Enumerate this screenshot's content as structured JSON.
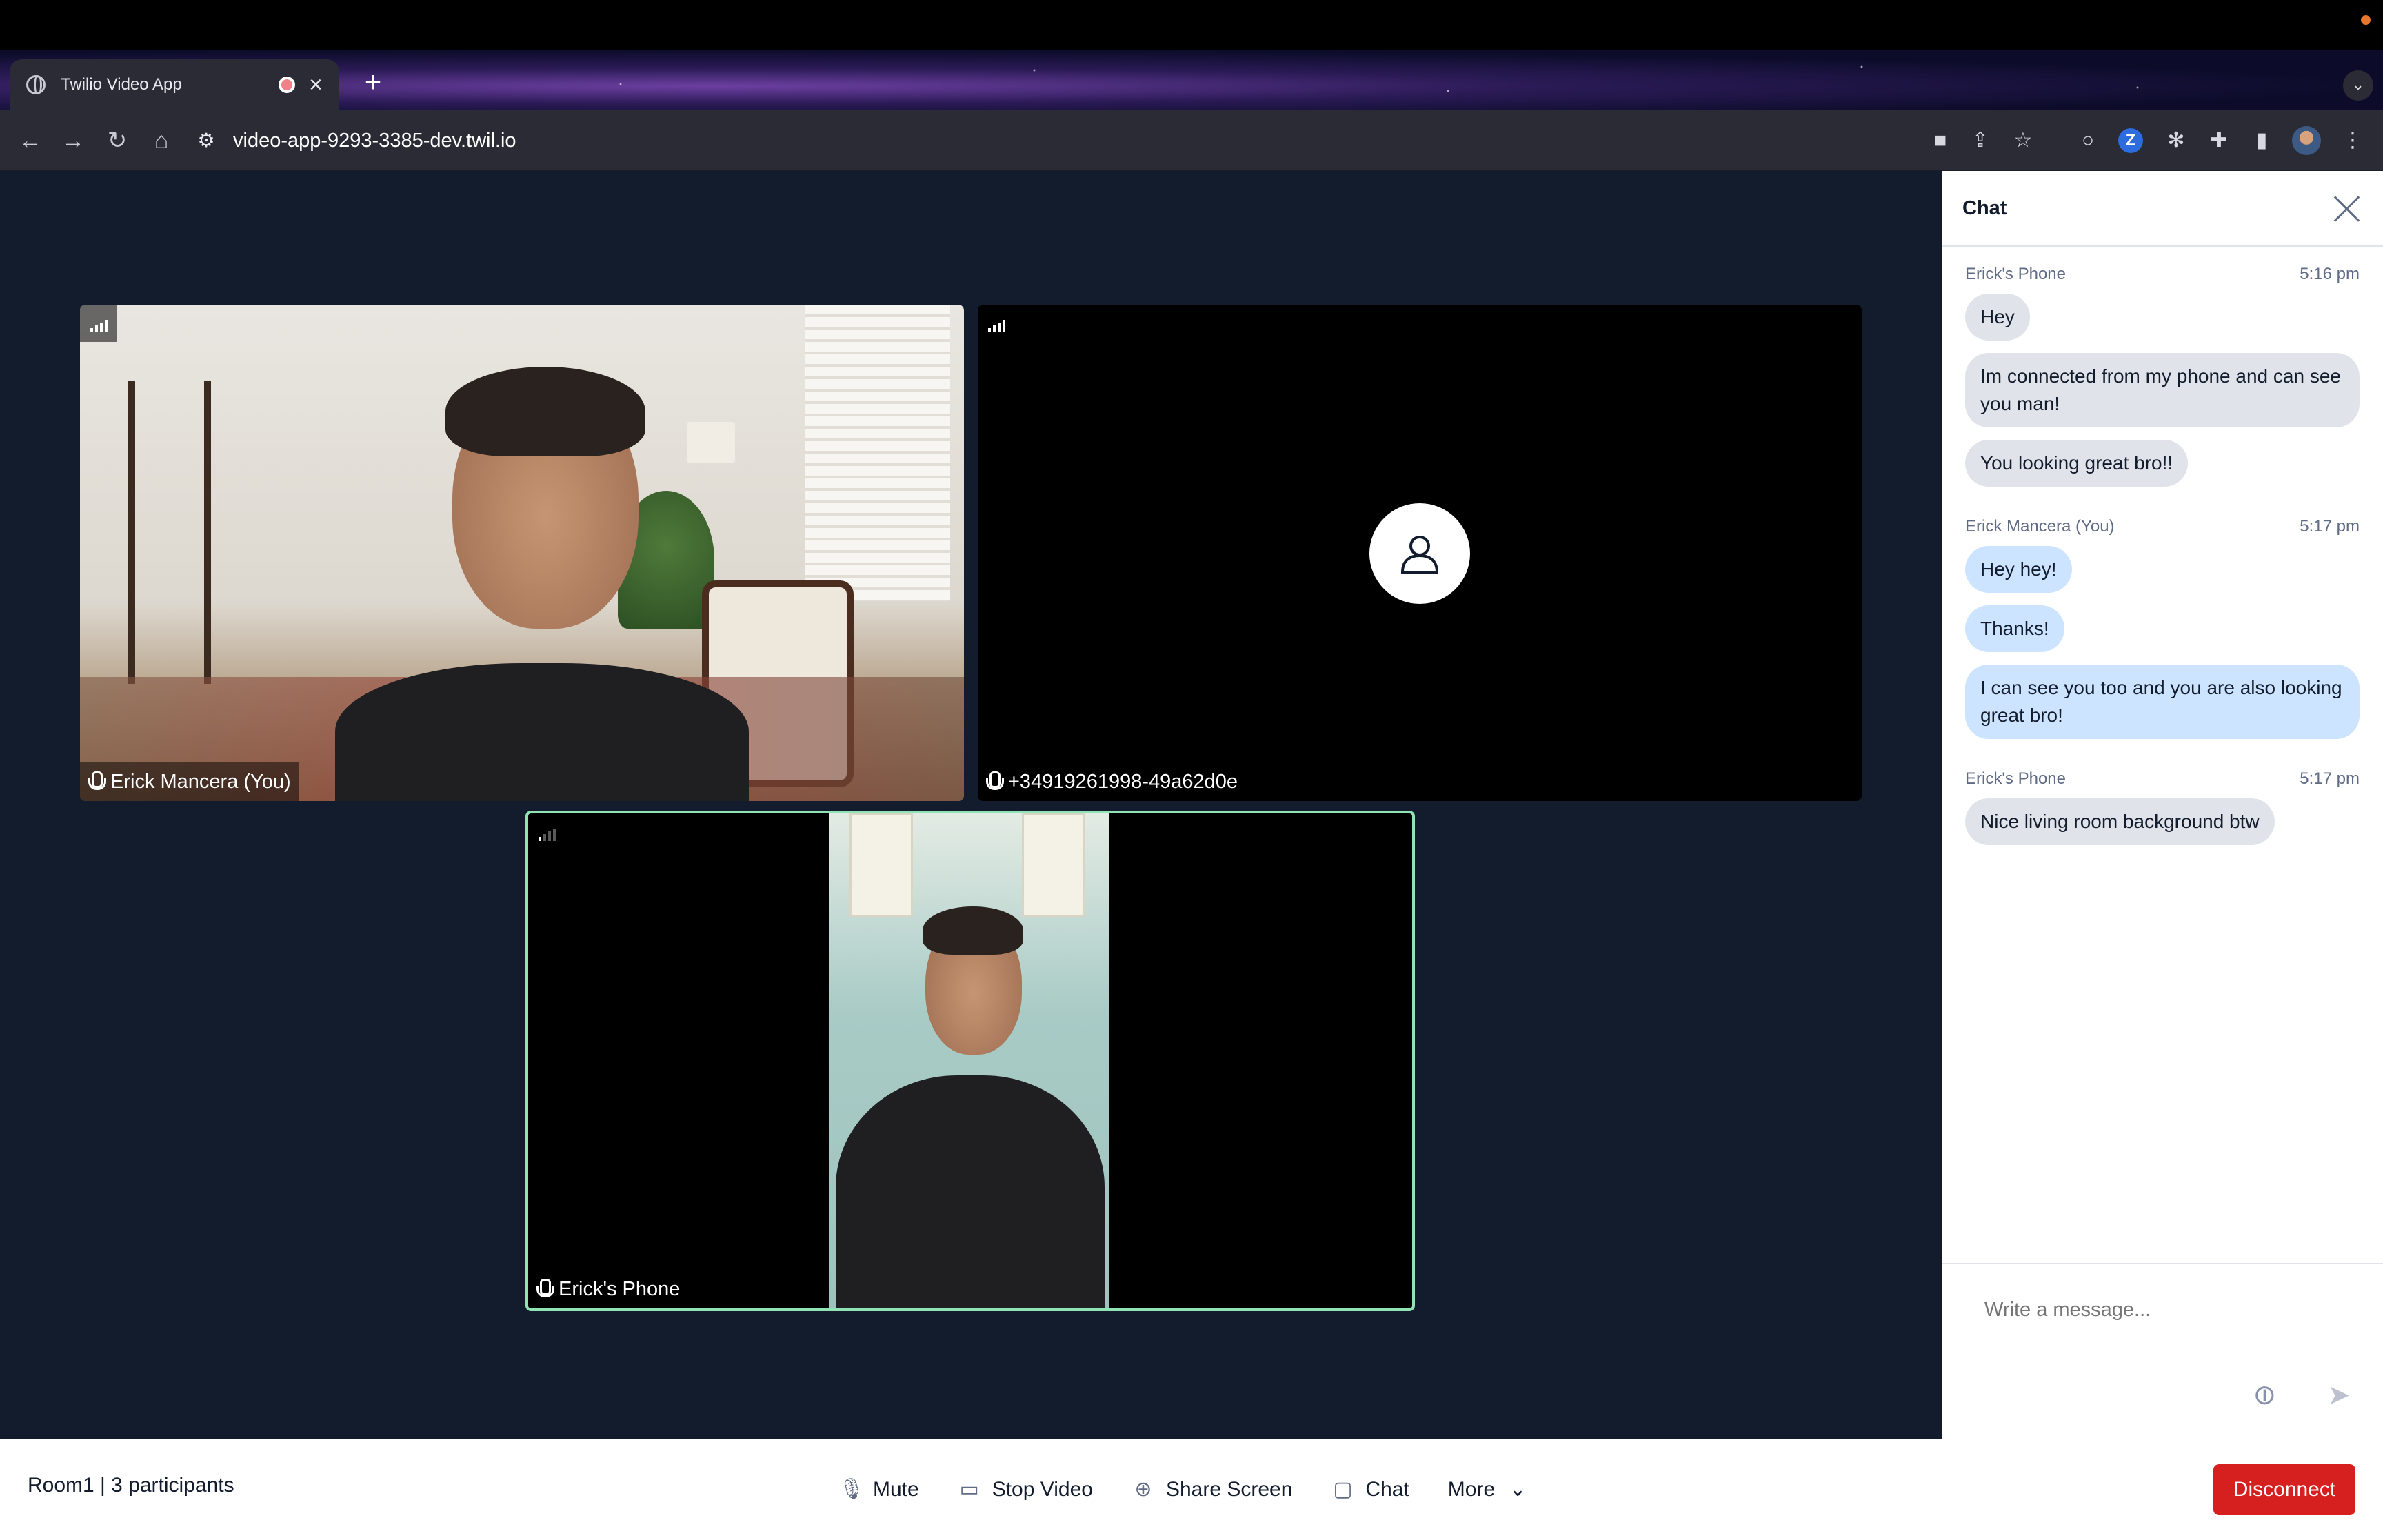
{
  "browser": {
    "tab_title": "Twilio Video App",
    "url": "video-app-9293-3385-dev.twil.io",
    "icons": [
      "back-icon",
      "forward-icon",
      "reload-icon",
      "home-icon",
      "site-info-icon",
      "camera-icon",
      "share-icon",
      "bookmark-star-icon",
      "extension-z-icon",
      "react-devtools-icon",
      "extensions-puzzle-icon",
      "side-panel-icon",
      "profile-avatar-icon",
      "menu-kebab-icon"
    ]
  },
  "participants": [
    {
      "name": "Erick Mancera (You)",
      "network": "full"
    },
    {
      "name": "+34919261998-49a62d0e",
      "network": "full"
    },
    {
      "name": "Erick's Phone",
      "network": "low",
      "active_speaker": true
    }
  ],
  "chat": {
    "title": "Chat",
    "groups": [
      {
        "author": "Erick's Phone",
        "time": "5:16 pm",
        "messages": [
          "Hey",
          "Im connected from my phone and can see you man!",
          "You looking great bro!!"
        ],
        "own": false
      },
      {
        "author": "Erick Mancera (You)",
        "time": "5:17 pm",
        "messages": [
          "Hey hey!",
          "Thanks!",
          "I can see you too and you are also looking great bro!"
        ],
        "own": true
      },
      {
        "author": "Erick's Phone",
        "time": "5:17 pm",
        "messages": [
          "Nice living room background btw"
        ],
        "own": false
      }
    ],
    "input_placeholder": "Write a message..."
  },
  "footer": {
    "room_info": "Room1 | 3 participants",
    "mute_label": "Mute",
    "stop_video_label": "Stop Video",
    "share_screen_label": "Share Screen",
    "chat_label": "Chat",
    "more_label": "More",
    "disconnect_label": "Disconnect"
  },
  "colors": {
    "stage_bg": "#121c2d",
    "active_border": "#8fe3b4",
    "bubble_in": "#e1e3ea",
    "bubble_out": "#cce4ff",
    "disconnect": "#d61f1f"
  }
}
